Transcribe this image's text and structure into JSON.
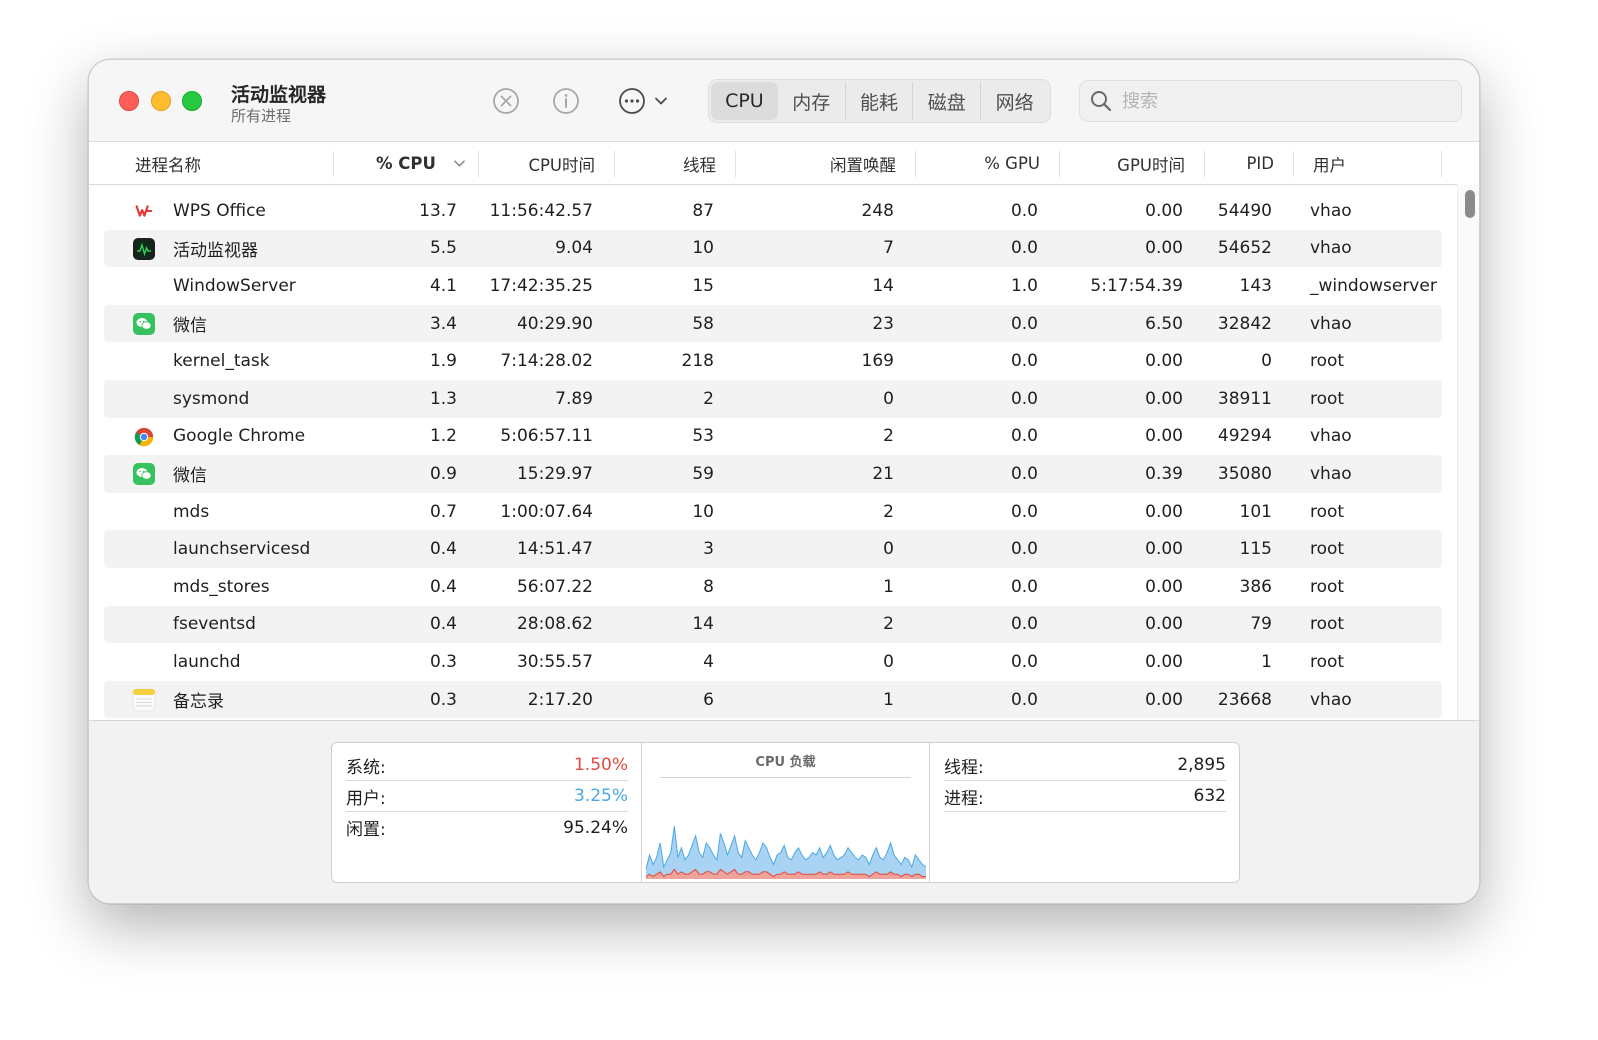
{
  "window": {
    "title": "活动监视器",
    "subtitle": "所有进程"
  },
  "toolbar": {
    "tabs": [
      "CPU",
      "内存",
      "能耗",
      "磁盘",
      "网络"
    ],
    "active_tab": "CPU",
    "search_placeholder": "搜索"
  },
  "table": {
    "columns": [
      "进程名称",
      "% CPU",
      "CPU时间",
      "线程",
      "闲置唤醒",
      "% GPU",
      "GPU时间",
      "PID",
      "用户"
    ],
    "sort_column": "% CPU",
    "rows": [
      {
        "name": "WPS Office",
        "icon": "wps-icon",
        "cpu": "13.7",
        "cpu_time": "11:56:42.57",
        "threads": "87",
        "idle_wake": "248",
        "gpu": "0.0",
        "gpu_time": "0.00",
        "pid": "54490",
        "user": "vhao"
      },
      {
        "name": "活动监视器",
        "icon": "activity-monitor-icon",
        "cpu": "5.5",
        "cpu_time": "9.04",
        "threads": "10",
        "idle_wake": "7",
        "gpu": "0.0",
        "gpu_time": "0.00",
        "pid": "54652",
        "user": "vhao"
      },
      {
        "name": "WindowServer",
        "icon": "",
        "cpu": "4.1",
        "cpu_time": "17:42:35.25",
        "threads": "15",
        "idle_wake": "14",
        "gpu": "1.0",
        "gpu_time": "5:17:54.39",
        "pid": "143",
        "user": "_windowserver"
      },
      {
        "name": "微信",
        "icon": "wechat-icon",
        "cpu": "3.4",
        "cpu_time": "40:29.90",
        "threads": "58",
        "idle_wake": "23",
        "gpu": "0.0",
        "gpu_time": "6.50",
        "pid": "32842",
        "user": "vhao"
      },
      {
        "name": "kernel_task",
        "icon": "",
        "cpu": "1.9",
        "cpu_time": "7:14:28.02",
        "threads": "218",
        "idle_wake": "169",
        "gpu": "0.0",
        "gpu_time": "0.00",
        "pid": "0",
        "user": "root"
      },
      {
        "name": "sysmond",
        "icon": "",
        "cpu": "1.3",
        "cpu_time": "7.89",
        "threads": "2",
        "idle_wake": "0",
        "gpu": "0.0",
        "gpu_time": "0.00",
        "pid": "38911",
        "user": "root"
      },
      {
        "name": "Google Chrome",
        "icon": "chrome-icon",
        "cpu": "1.2",
        "cpu_time": "5:06:57.11",
        "threads": "53",
        "idle_wake": "2",
        "gpu": "0.0",
        "gpu_time": "0.00",
        "pid": "49294",
        "user": "vhao"
      },
      {
        "name": "微信",
        "icon": "wechat-icon",
        "cpu": "0.9",
        "cpu_time": "15:29.97",
        "threads": "59",
        "idle_wake": "21",
        "gpu": "0.0",
        "gpu_time": "0.39",
        "pid": "35080",
        "user": "vhao"
      },
      {
        "name": "mds",
        "icon": "",
        "cpu": "0.7",
        "cpu_time": "1:00:07.64",
        "threads": "10",
        "idle_wake": "2",
        "gpu": "0.0",
        "gpu_time": "0.00",
        "pid": "101",
        "user": "root"
      },
      {
        "name": "launchservicesd",
        "icon": "",
        "cpu": "0.4",
        "cpu_time": "14:51.47",
        "threads": "3",
        "idle_wake": "0",
        "gpu": "0.0",
        "gpu_time": "0.00",
        "pid": "115",
        "user": "root"
      },
      {
        "name": "mds_stores",
        "icon": "",
        "cpu": "0.4",
        "cpu_time": "56:07.22",
        "threads": "8",
        "idle_wake": "1",
        "gpu": "0.0",
        "gpu_time": "0.00",
        "pid": "386",
        "user": "root"
      },
      {
        "name": "fseventsd",
        "icon": "",
        "cpu": "0.4",
        "cpu_time": "28:08.62",
        "threads": "14",
        "idle_wake": "2",
        "gpu": "0.0",
        "gpu_time": "0.00",
        "pid": "79",
        "user": "root"
      },
      {
        "name": "launchd",
        "icon": "",
        "cpu": "0.3",
        "cpu_time": "30:55.57",
        "threads": "4",
        "idle_wake": "0",
        "gpu": "0.0",
        "gpu_time": "0.00",
        "pid": "1",
        "user": "root"
      },
      {
        "name": "备忘录",
        "icon": "notes-icon",
        "cpu": "0.3",
        "cpu_time": "2:17.20",
        "threads": "6",
        "idle_wake": "1",
        "gpu": "0.0",
        "gpu_time": "0.00",
        "pid": "23668",
        "user": "vhao"
      }
    ]
  },
  "summary": {
    "system_label": "系统:",
    "system_value": "1.50%",
    "user_label": "用户:",
    "user_value": "3.25%",
    "idle_label": "闲置:",
    "idle_value": "95.24%",
    "graph_title": "CPU 负载",
    "threads_label": "线程:",
    "threads_value": "2,895",
    "processes_label": "进程:",
    "processes_value": "632"
  },
  "colors": {
    "system": "#e04a3f",
    "user": "#4aa8e6",
    "graph_user_fill": "#a9d3f2",
    "graph_system_fill": "#f0a39b"
  },
  "cpu_load_history": {
    "user": [
      3,
      8,
      5,
      7,
      12,
      4,
      6,
      9,
      18,
      7,
      10,
      6,
      8,
      11,
      14,
      9,
      7,
      12,
      10,
      8,
      6,
      15,
      12,
      8,
      11,
      14,
      9,
      7,
      13,
      10,
      8,
      6,
      9,
      12,
      10,
      7,
      5,
      8,
      9,
      11,
      7,
      6,
      9,
      10,
      8,
      6,
      7,
      9,
      8,
      10,
      7,
      9,
      11,
      8,
      6,
      7,
      8,
      10,
      9,
      7,
      6,
      8,
      7,
      5,
      8,
      10,
      7,
      6,
      9,
      12,
      8,
      6,
      5,
      7,
      6,
      4,
      8,
      6,
      5,
      4
    ],
    "system": [
      1,
      2,
      1,
      2,
      3,
      1,
      2,
      2,
      4,
      2,
      3,
      2,
      2,
      3,
      4,
      2,
      2,
      3,
      3,
      2,
      2,
      4,
      3,
      2,
      3,
      4,
      2,
      2,
      3,
      3,
      2,
      2,
      2,
      3,
      3,
      2,
      1,
      2,
      2,
      3,
      2,
      2,
      2,
      3,
      2,
      2,
      2,
      2,
      2,
      3,
      2,
      2,
      3,
      2,
      2,
      2,
      2,
      3,
      2,
      2,
      2,
      2,
      2,
      1,
      2,
      3,
      2,
      2,
      2,
      3,
      2,
      2,
      1,
      2,
      2,
      1,
      2,
      2,
      1,
      1
    ]
  }
}
